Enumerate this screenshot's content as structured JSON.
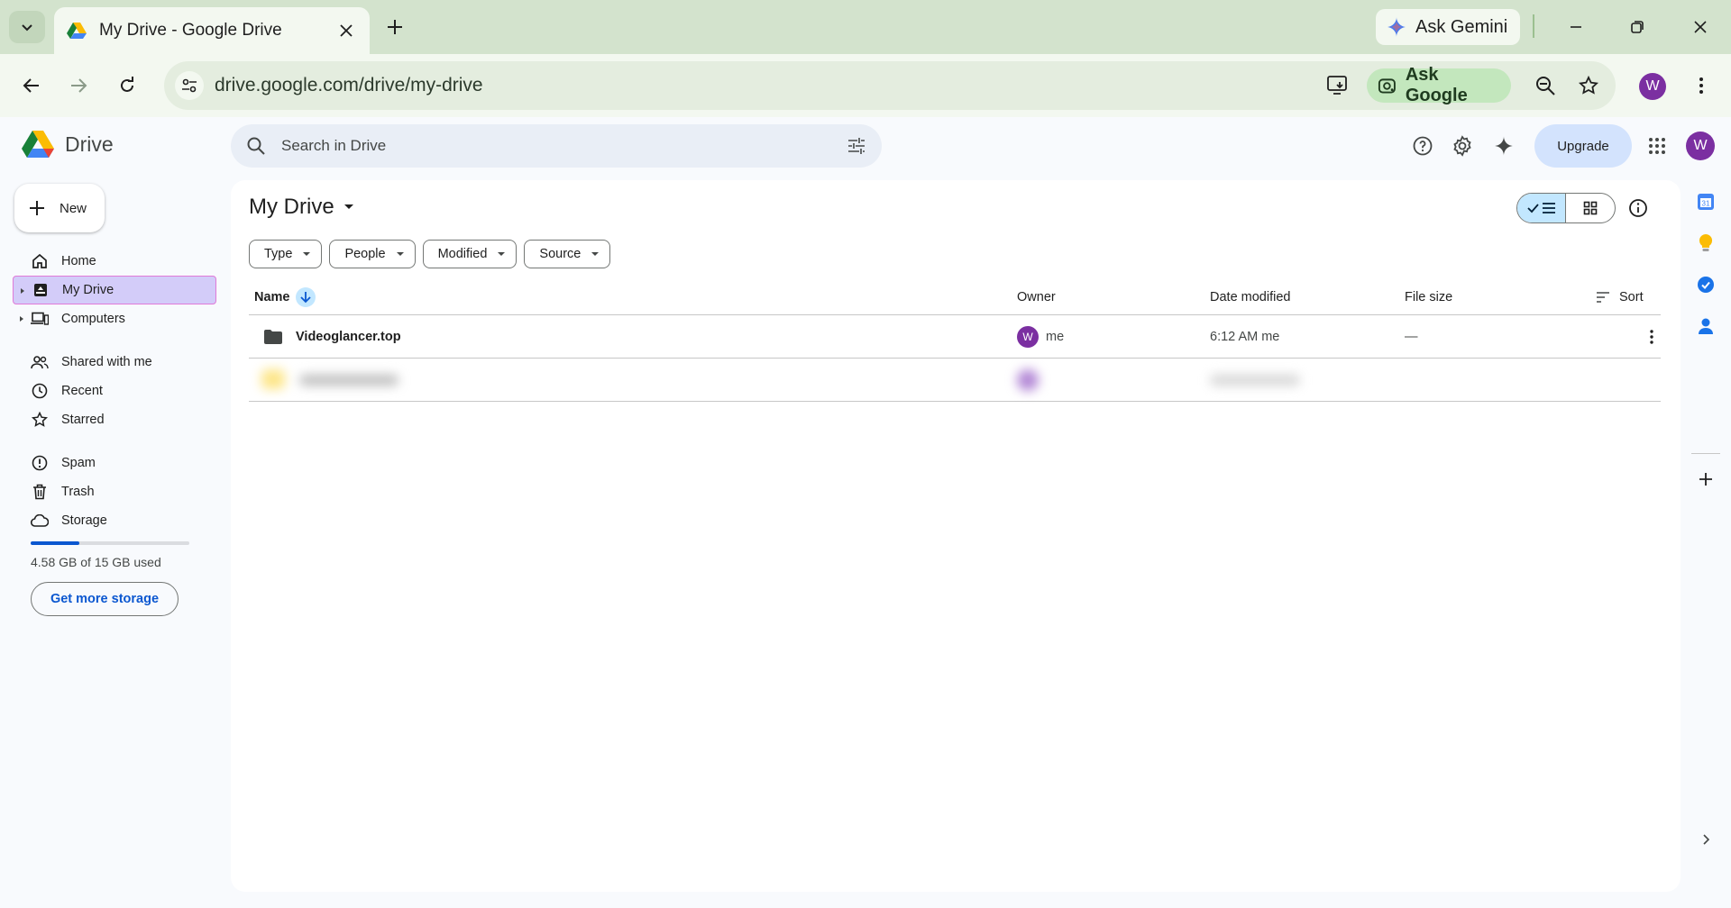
{
  "browser": {
    "tab_title": "My Drive - Google Drive",
    "ask_gemini": "Ask Gemini",
    "url": "drive.google.com/drive/my-drive",
    "ask_google": "Ask Google",
    "profile_initial": "W"
  },
  "header": {
    "app_name": "Drive",
    "search_placeholder": "Search in Drive",
    "upgrade_label": "Upgrade",
    "account_initial": "W"
  },
  "sidebar": {
    "new_label": "New",
    "groups": [
      [
        {
          "label": "Home",
          "icon": "home-icon"
        },
        {
          "label": "My Drive",
          "icon": "my-drive-icon",
          "active": true,
          "expandable": true
        },
        {
          "label": "Computers",
          "icon": "computers-icon",
          "expandable": true
        }
      ],
      [
        {
          "label": "Shared with me",
          "icon": "shared-icon"
        },
        {
          "label": "Recent",
          "icon": "clock-icon"
        },
        {
          "label": "Starred",
          "icon": "star-icon"
        }
      ],
      [
        {
          "label": "Spam",
          "icon": "spam-icon"
        },
        {
          "label": "Trash",
          "icon": "trash-icon"
        },
        {
          "label": "Storage",
          "icon": "cloud-icon"
        }
      ]
    ],
    "storage_used_fraction": 0.305,
    "storage_text": "4.58 GB of 15 GB used",
    "get_more_storage": "Get more storage"
  },
  "main": {
    "title": "My Drive",
    "filters": [
      "Type",
      "People",
      "Modified",
      "Source"
    ],
    "columns": {
      "name": "Name",
      "owner": "Owner",
      "date_modified": "Date modified",
      "file_size": "File size",
      "sort": "Sort"
    },
    "rows": [
      {
        "name": "Videoglancer.top",
        "owner_initial": "W",
        "owner": "me",
        "date": "6:12 AM me",
        "size": "—"
      }
    ]
  },
  "colors": {
    "accent": "#0b57d0",
    "avatar": "#7b2fa1",
    "selected_nav": "#d3ccf9"
  }
}
